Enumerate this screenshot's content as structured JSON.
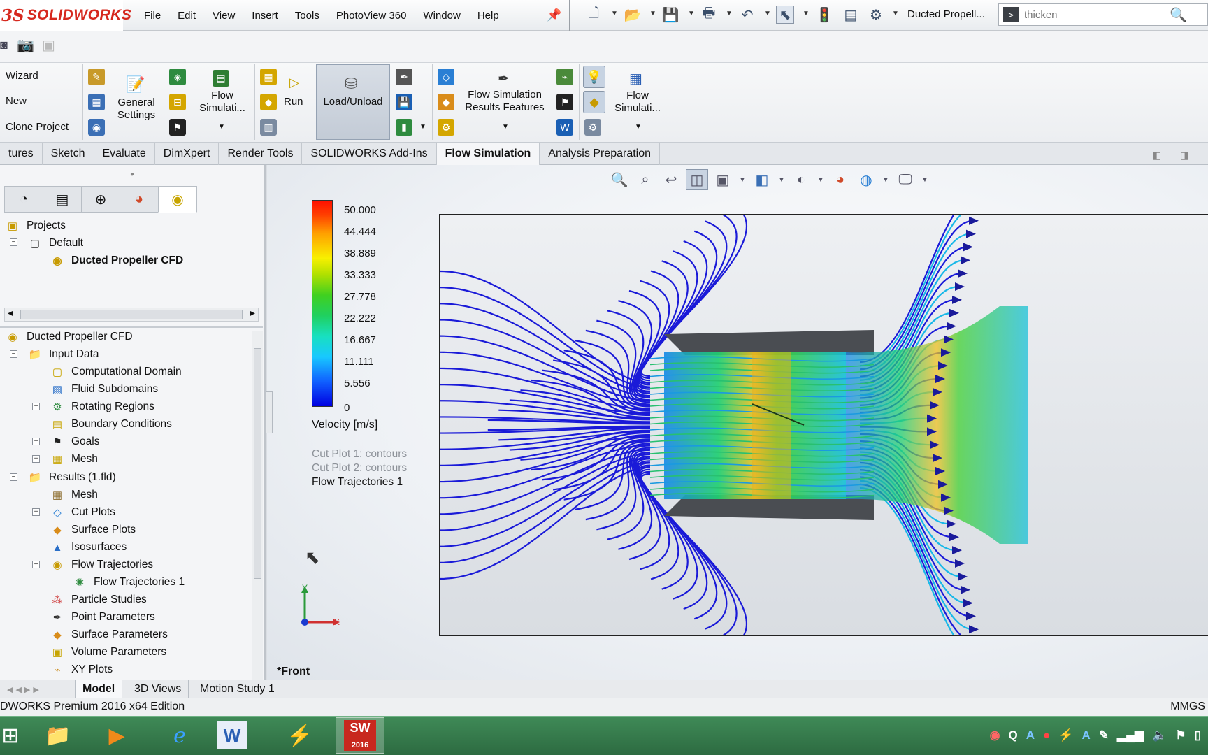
{
  "app": {
    "brand": "SOLIDWORKS",
    "menu": [
      "File",
      "Edit",
      "View",
      "Insert",
      "Tools",
      "PhotoView 360",
      "Window",
      "Help"
    ],
    "document_title": "Ducted Propell...",
    "search": {
      "value": "thicken"
    }
  },
  "command_manager": {
    "project_group": [
      "Wizard",
      "New",
      "Clone Project"
    ],
    "general_settings": "General\nSettings",
    "flow_simulation_1": "Flow\nSimulati...",
    "run": "Run",
    "load_unload": "Load/Unload",
    "results_features": "Flow Simulation\nResults Features",
    "flow_simulation_2": "Flow\nSimulati..."
  },
  "tabs": [
    {
      "label": "tures",
      "active": false
    },
    {
      "label": "Sketch",
      "active": false
    },
    {
      "label": "Evaluate",
      "active": false
    },
    {
      "label": "DimXpert",
      "active": false
    },
    {
      "label": "Render Tools",
      "active": false
    },
    {
      "label": "SOLIDWORKS Add-Ins",
      "active": false
    },
    {
      "label": "Flow Simulation",
      "active": true
    },
    {
      "label": "Analysis Preparation",
      "active": false
    }
  ],
  "projects_tree": {
    "root": "Projects",
    "default": "Default",
    "project": "Ducted Propeller CFD"
  },
  "analysis_tree": {
    "root": "Ducted Propeller CFD",
    "items": [
      {
        "label": "Input Data",
        "icon": "input-data-icon"
      },
      {
        "label": "Computational Domain",
        "icon": "domain-icon"
      },
      {
        "label": "Fluid Subdomains",
        "icon": "subdomain-icon"
      },
      {
        "label": "Rotating Regions",
        "icon": "rotating-icon"
      },
      {
        "label": "Boundary Conditions",
        "icon": "boundary-icon"
      },
      {
        "label": "Goals",
        "icon": "goals-icon"
      },
      {
        "label": "Mesh",
        "icon": "mesh-icon"
      },
      {
        "label": "Results (1.fld)",
        "icon": "results-icon"
      },
      {
        "label": "Mesh",
        "icon": "mesh-icon"
      },
      {
        "label": "Cut Plots",
        "icon": "cut-plots-icon"
      },
      {
        "label": "Surface Plots",
        "icon": "surface-plots-icon"
      },
      {
        "label": "Isosurfaces",
        "icon": "isosurface-icon"
      },
      {
        "label": "Flow Trajectories",
        "icon": "trajectories-icon"
      },
      {
        "label": "Flow Trajectories 1",
        "icon": "trajectory-icon"
      },
      {
        "label": "Particle Studies",
        "icon": "particle-icon"
      },
      {
        "label": "Point Parameters",
        "icon": "point-param-icon"
      },
      {
        "label": "Surface Parameters",
        "icon": "surface-param-icon"
      },
      {
        "label": "Volume Parameters",
        "icon": "volume-param-icon"
      },
      {
        "label": "XY Plots",
        "icon": "xy-plots-icon"
      }
    ]
  },
  "legend": {
    "title": "Velocity [m/s]",
    "values": [
      "50.000",
      "44.444",
      "38.889",
      "33.333",
      "27.778",
      "22.222",
      "16.667",
      "11.111",
      "5.556",
      "0"
    ]
  },
  "plot_list": [
    "Cut Plot 1: contours",
    "Cut Plot 2: contours",
    "Flow Trajectories 1"
  ],
  "view": {
    "name": "*Front",
    "axis_y": "Y",
    "axis_x": "X"
  },
  "bottom_tabs": [
    {
      "label": "Model",
      "active": true
    },
    {
      "label": "3D Views",
      "active": false
    },
    {
      "label": "Motion Study 1",
      "active": false
    }
  ],
  "status": {
    "edition": "DWORKS Premium 2016 x64 Edition",
    "units": "MMGS"
  },
  "taskbar": {
    "sw_badge": "2016"
  },
  "colors": {
    "brand_red": "#d6281e",
    "trajectory_blue": "#1a1ad8",
    "duct_gray": "#4a4d52"
  }
}
